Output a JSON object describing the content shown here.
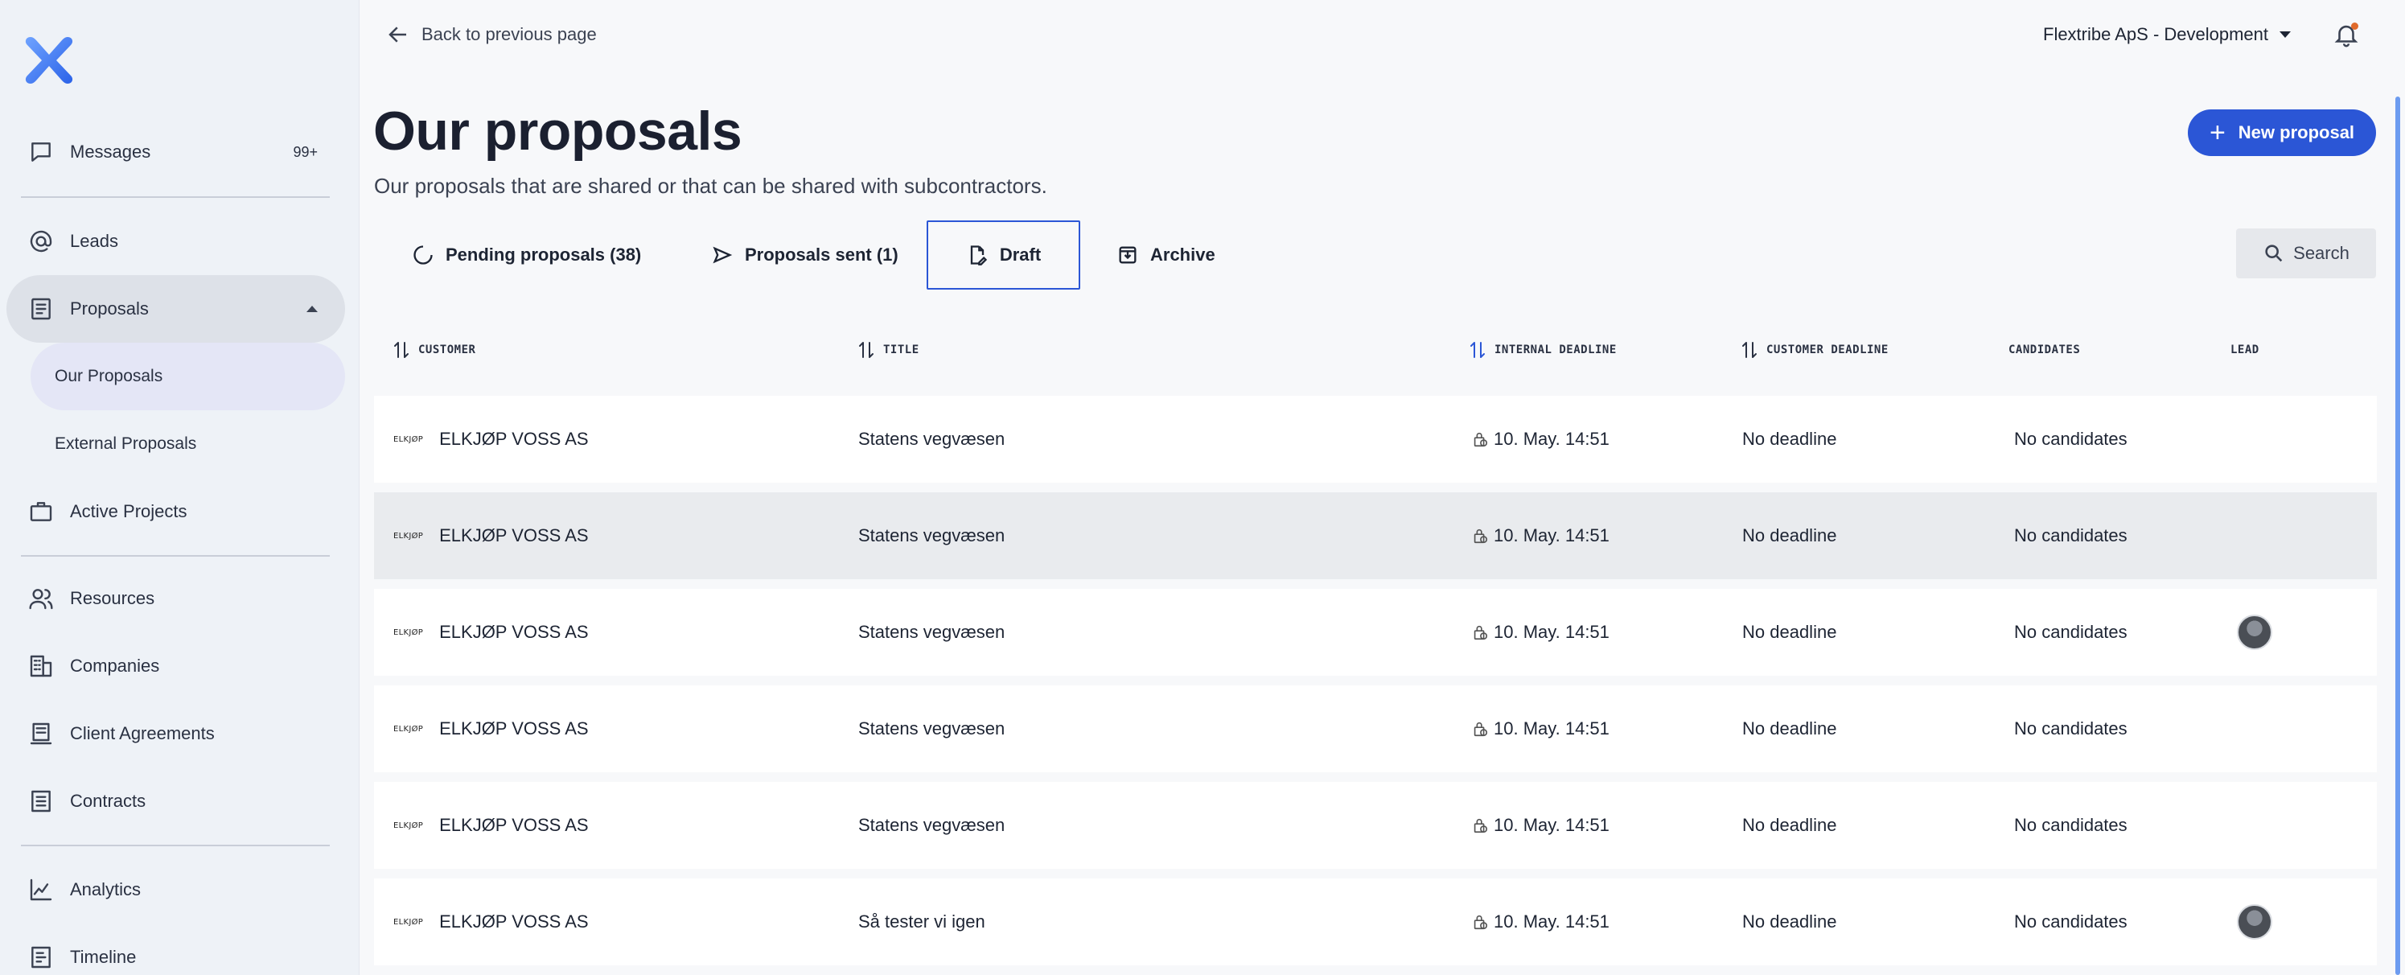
{
  "sidebar": {
    "items": [
      {
        "label": "Messages",
        "badge": "99+",
        "icon": "chat-icon"
      },
      {
        "label": "Leads",
        "icon": "at-icon"
      },
      {
        "label": "Proposals",
        "icon": "document-icon"
      },
      {
        "label": "Active Projects",
        "icon": "briefcase-icon"
      },
      {
        "label": "Resources",
        "icon": "users-icon"
      },
      {
        "label": "Companies",
        "icon": "building-icon"
      },
      {
        "label": "Client Agreements",
        "icon": "agreement-icon"
      },
      {
        "label": "Contracts",
        "icon": "contract-icon"
      },
      {
        "label": "Analytics",
        "icon": "chart-icon"
      },
      {
        "label": "Timeline",
        "icon": "timeline-icon"
      }
    ],
    "proposals_sub": [
      {
        "label": "Our Proposals"
      },
      {
        "label": "External Proposals"
      }
    ]
  },
  "topbar": {
    "back_label": "Back to previous page",
    "org_label": "Flextribe ApS - Development"
  },
  "header": {
    "title": "Our proposals",
    "subtitle": "Our proposals that are shared or that can be shared with subcontractors.",
    "new_button": "New proposal"
  },
  "tabs": [
    {
      "label": "Pending proposals (38)"
    },
    {
      "label": "Proposals sent (1)"
    },
    {
      "label": "Draft"
    },
    {
      "label": "Archive"
    }
  ],
  "search_label": "Search",
  "table": {
    "columns": [
      "CUSTOMER",
      "TITLE",
      "INTERNAL DEADLINE",
      "CUSTOMER DEADLINE",
      "CANDIDATES",
      "LEAD"
    ],
    "logo_text": "ELKJØP",
    "rows": [
      {
        "customer": "ELKJØP VOSS AS",
        "title": "Statens vegvæsen",
        "internal_deadline": "10. May. 14:51",
        "customer_deadline": "No deadline",
        "candidates": "No candidates",
        "lead_avatar": false
      },
      {
        "customer": "ELKJØP VOSS AS",
        "title": "Statens vegvæsen",
        "internal_deadline": "10. May. 14:51",
        "customer_deadline": "No deadline",
        "candidates": "No candidates",
        "lead_avatar": false
      },
      {
        "customer": "ELKJØP VOSS AS",
        "title": "Statens vegvæsen",
        "internal_deadline": "10. May. 14:51",
        "customer_deadline": "No deadline",
        "candidates": "No candidates",
        "lead_avatar": true
      },
      {
        "customer": "ELKJØP VOSS AS",
        "title": "Statens vegvæsen",
        "internal_deadline": "10. May. 14:51",
        "customer_deadline": "No deadline",
        "candidates": "No candidates",
        "lead_avatar": false
      },
      {
        "customer": "ELKJØP VOSS AS",
        "title": "Statens vegvæsen",
        "internal_deadline": "10. May. 14:51",
        "customer_deadline": "No deadline",
        "candidates": "No candidates",
        "lead_avatar": false
      },
      {
        "customer": "ELKJØP VOSS AS",
        "title": "Så tester vi igen",
        "internal_deadline": "10. May. 14:51",
        "customer_deadline": "No deadline",
        "candidates": "No candidates",
        "lead_avatar": true
      }
    ]
  },
  "colors": {
    "accent": "#2b56d6",
    "sidebar_bg": "#eef2f7",
    "page_bg": "#f7f8fa"
  }
}
